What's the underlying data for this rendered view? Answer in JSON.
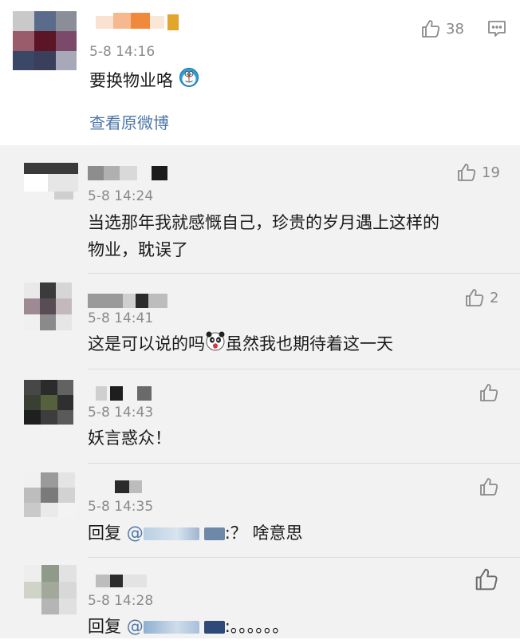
{
  "top_comment": {
    "time": "5-8 14:16",
    "text": "要换物业咯",
    "likes": "38",
    "view_original": "查看原微博"
  },
  "replies": [
    {
      "time": "5-8 14:24",
      "text_line1": "当选那年我就感慨自己，珍贵的岁月遇上这样的",
      "text_line2": "物业，耽误了",
      "likes": "19"
    },
    {
      "time": "5-8 14:41",
      "text_part1": "这是可以说的吗",
      "text_part2": "虽然我也期待着这一天",
      "likes": "2"
    },
    {
      "time": "5-8 14:43",
      "text": "妖言惑众！"
    },
    {
      "time": "5-8 14:35",
      "reply_prefix": "回复",
      "at": "@",
      "text_suffix": ":？ 啥意思"
    },
    {
      "time": "5-8 14:28",
      "reply_prefix": "回复",
      "at": "@",
      "text_suffix": ":。。。。。。"
    }
  ],
  "colors": {
    "link": "#4e77a8",
    "time": "#8a8a8a",
    "reply_background": "#f2f2f2"
  }
}
